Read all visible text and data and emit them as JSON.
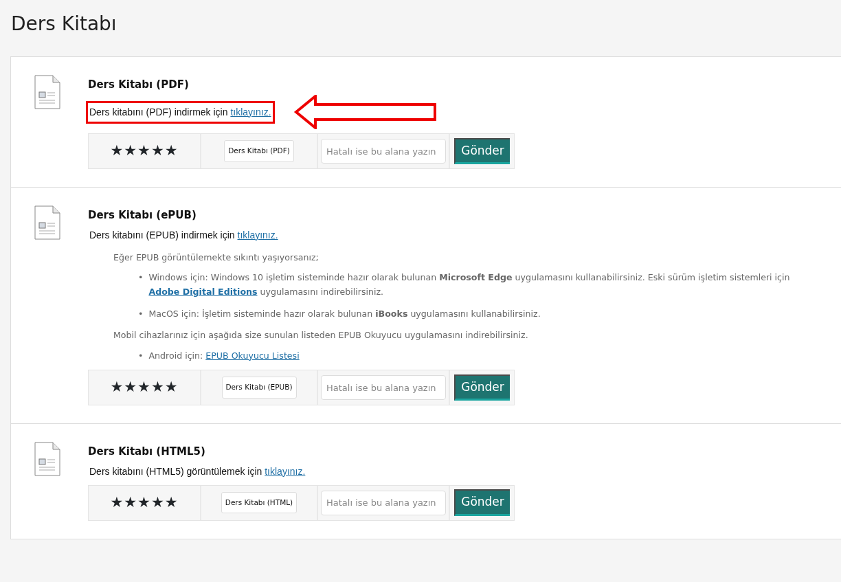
{
  "page_title": "Ders Kitabı",
  "resources": [
    {
      "title": "Ders Kitabı (PDF)",
      "description": "Ders kitabını (PDF) indirmek için ",
      "link": "tıklayınız.",
      "highlighted": true,
      "stars": 5,
      "name_value": "Ders Kitabı (PDF)",
      "feedback_placeholder": "Hatalı ise bu alana yazın",
      "submit": "Gönder"
    },
    {
      "title": "Ders Kitabı (ePUB)",
      "description": "Ders kitabını (EPUB) indirmek için ",
      "link": "tıklayınız.",
      "highlighted": false,
      "notes": [
        {
          "kind": "paragraph",
          "parts": [
            {
              "text": "Eğer EPUB görüntülemekte sıkıntı yaşıyorsanız;"
            }
          ]
        },
        {
          "kind": "list",
          "items": [
            {
              "bullet": "•",
              "parts": [
                {
                  "text": "Windows için: Windows 10 işletim sisteminde hazır olarak bulunan **Microsoft Edge** uygulamasını kullanabilirsiniz. Eski sürüm işletim sistemleri için "
                },
                {
                  "link": "Adobe Digital Editions",
                  "bold": true
                },
                {
                  "text": "  uygulamasını indirebilirsiniz."
                }
              ]
            },
            {
              "bullet": "•",
              "parts": [
                {
                  "text": "MacOS için: İşletim sisteminde hazır olarak bulunan **iBooks** uygulamasını kullanabilirsiniz."
                }
              ]
            }
          ]
        },
        {
          "kind": "paragraph",
          "parts": [
            {
              "text": "Mobil cihazlarınız için aşağıda size sunulan listeden EPUB Okuyucu uygulamasını indirebilirsiniz."
            }
          ]
        },
        {
          "kind": "list",
          "items": [
            {
              "bullet": "•",
              "parts": [
                {
                  "text": "Android için: "
                },
                {
                  "link": "EPUB Okuyucu Listesi",
                  "bold": false
                }
              ]
            }
          ]
        }
      ],
      "stars": 5,
      "name_value": "Ders Kitabı (EPUB)",
      "feedback_placeholder": "Hatalı ise bu alana yazın",
      "submit": "Gönder"
    },
    {
      "title": "Ders Kitabı (HTML5)",
      "description": "Ders kitabını (HTML5) görüntülemek için ",
      "link": "tıklayınız.",
      "highlighted": false,
      "stars": 5,
      "name_value": "Ders Kitabı (HTML)",
      "feedback_placeholder": "Hatalı ise bu alana yazın",
      "submit": "Gönder"
    }
  ]
}
